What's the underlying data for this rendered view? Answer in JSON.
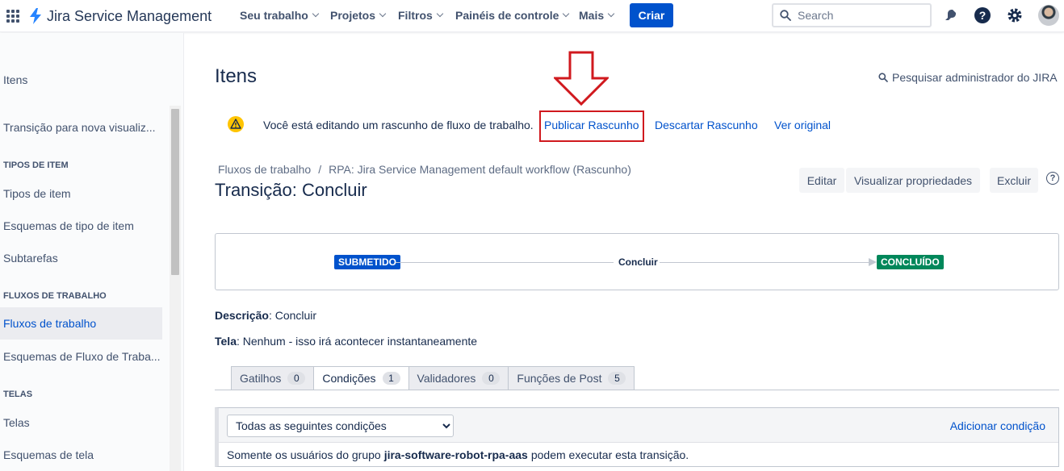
{
  "topnav": {
    "app_name": "Jira Service Management",
    "items": [
      "Seu trabalho",
      "Projetos",
      "Filtros",
      "Painéis de controle",
      "Mais"
    ],
    "create_label": "Criar",
    "search_placeholder": "Search",
    "icons": [
      "apps-grid-icon",
      "notifications-icon",
      "help-icon",
      "settings-icon",
      "user-avatar"
    ]
  },
  "sidebar": {
    "title": "Itens",
    "items": {
      "transition_new_view": "Transição para nova visualiz...",
      "section_item_types": "TIPOS DE ITEM",
      "item_types": "Tipos de item",
      "item_type_schemes": "Esquemas de tipo de item",
      "subtasks": "Subtarefas",
      "section_workflows": "FLUXOS DE TRABALHO",
      "workflows": "Fluxos de trabalho",
      "workflow_schemes": "Esquemas de Fluxo de Traba...",
      "section_screens": "TELAS",
      "screens": "Telas",
      "screen_schemes": "Esquemas de tela"
    }
  },
  "main": {
    "title": "Itens",
    "admin_search": "Pesquisar administrador do JIRA",
    "draft": {
      "message": "Você está editando um rascunho de fluxo de trabalho.",
      "publish": "Publicar Rascunho",
      "discard": "Descartar Rascunho",
      "view_original": "Ver original"
    },
    "breadcrumb": {
      "root": "Fluxos de trabalho",
      "separator": "/",
      "current": "RPA: Jira Service Management default workflow (Rascunho)"
    },
    "transition_title": "Transição: Concluir",
    "buttons": {
      "edit": "Editar",
      "view_properties": "Visualizar propriedades",
      "delete": "Excluir",
      "help": "?"
    },
    "diagram": {
      "from_status": "SUBMETIDO",
      "transition": "Concluir",
      "to_status": "CONCLUÍDO",
      "from_color": "#0052cc",
      "to_color": "#00875a"
    },
    "description_label": "Descrição",
    "description_value": ": Concluir",
    "screen_label": "Tela",
    "screen_value": ": Nenhum - isso irá acontecer instantaneamente",
    "tabs": [
      {
        "label": "Gatilhos",
        "count": "0"
      },
      {
        "label": "Condições",
        "count": "1"
      },
      {
        "label": "Validadores",
        "count": "0"
      },
      {
        "label": "Funções de Post",
        "count": "5"
      }
    ],
    "conditions": {
      "select_value": "Todas as seguintes condições",
      "add_label": "Adicionar condição",
      "text_before": "Somente os usuários do grupo",
      "group": "jira-software-robot-rpa-aas",
      "text_after": "podem executar esta transição."
    }
  }
}
